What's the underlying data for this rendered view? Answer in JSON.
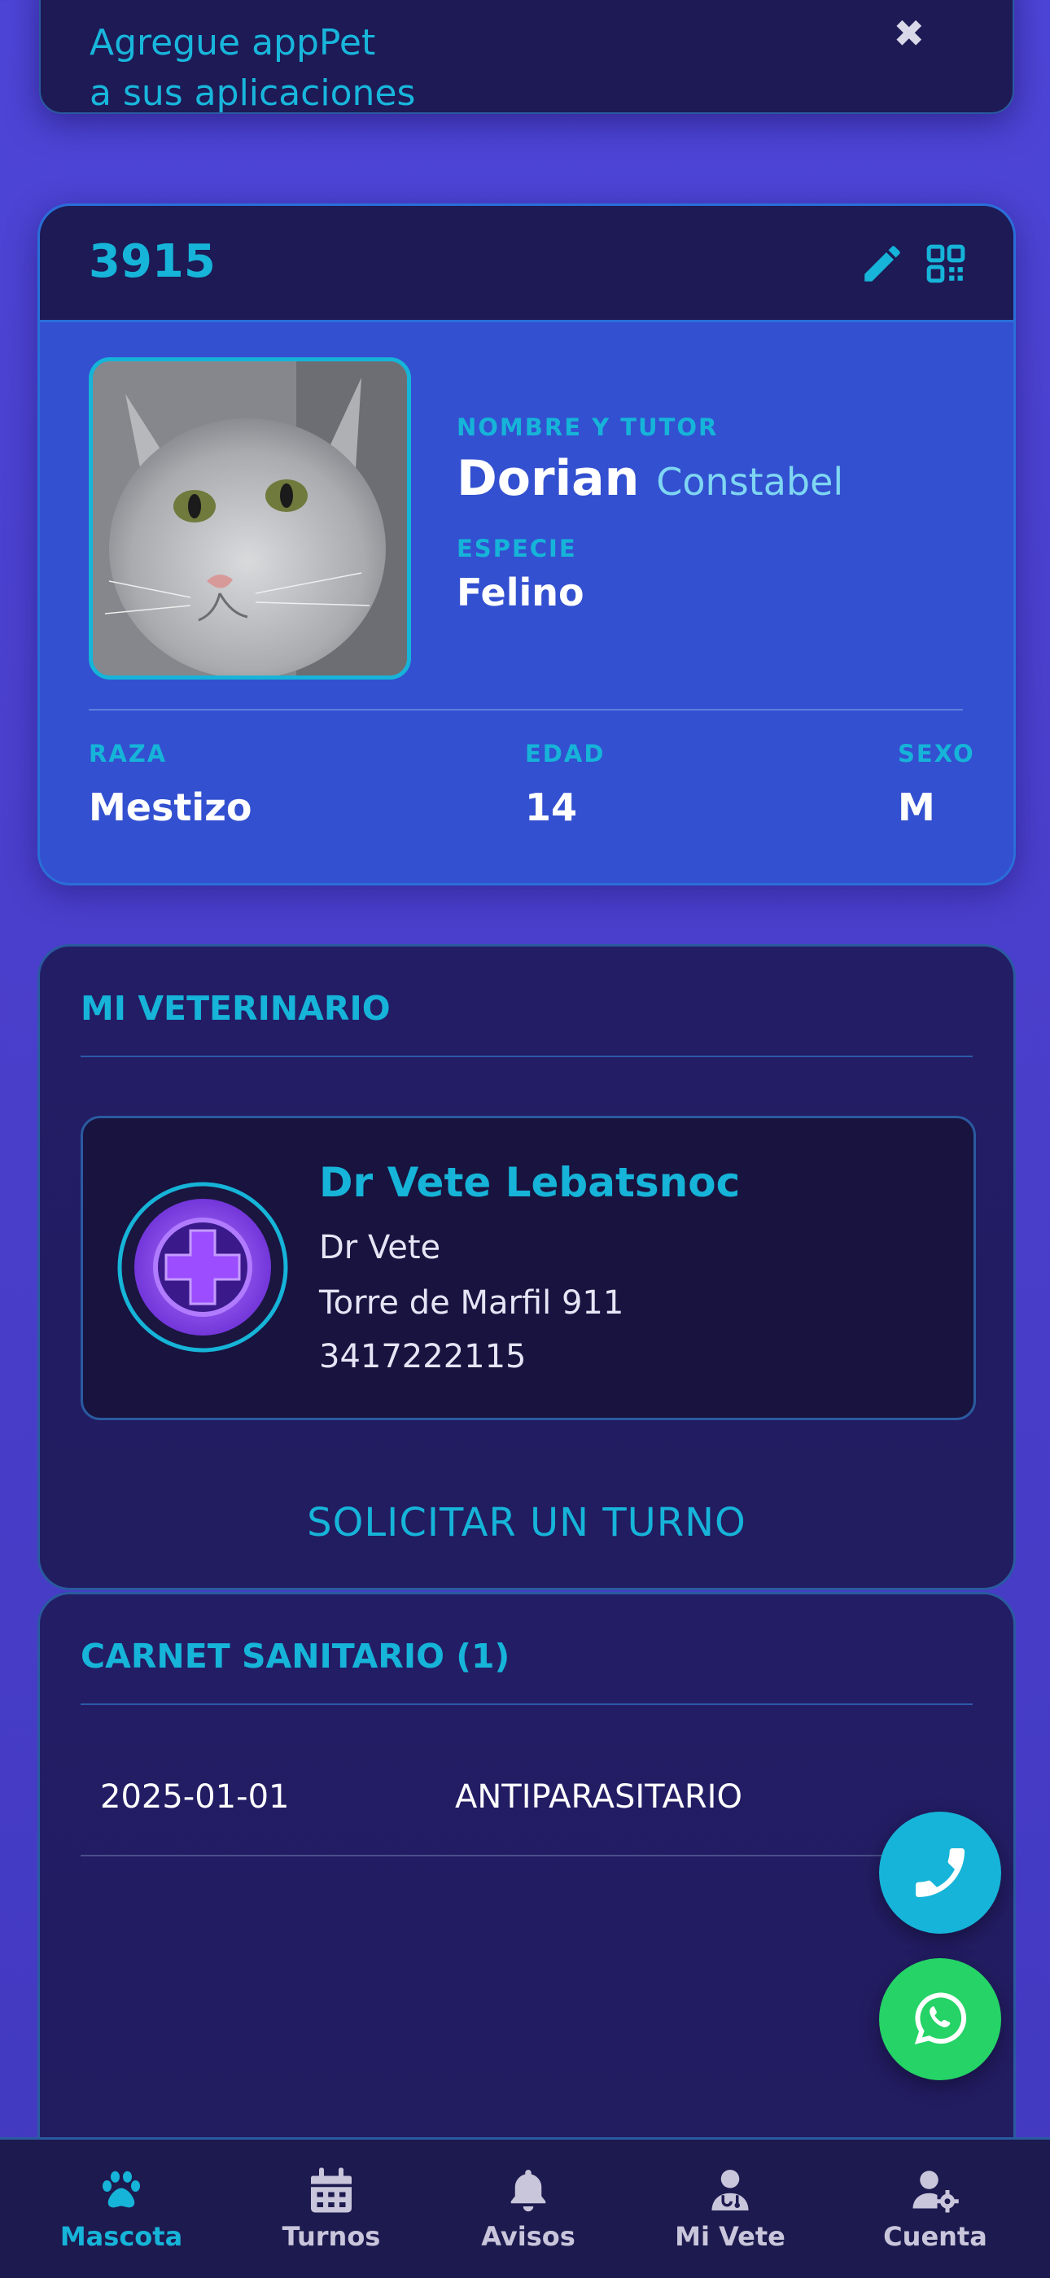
{
  "banner": {
    "text_line1": "Agregue appPet",
    "text_line2": "a sus aplicaciones",
    "close_glyph": "✖"
  },
  "pet": {
    "id": "3915",
    "name_label": "NOMBRE Y TUTOR",
    "name": "Dorian",
    "tutor": "Constabel",
    "species_label": "ESPECIE",
    "species": "Felino",
    "breed_label": "RAZA",
    "breed": "Mestizo",
    "age_label": "EDAD",
    "age": "14",
    "sex_label": "SEXO",
    "sex": "M",
    "icons": [
      "pencil-icon",
      "qr-code-icon"
    ]
  },
  "vet": {
    "title": "MI VETERINARIO",
    "name": "Dr Vete Lebatsnoc",
    "doctor": "Dr Vete",
    "address": "Torre de Marfil 911",
    "phone": "3417222115",
    "cta": "SOLICITAR UN TURNO"
  },
  "carnet": {
    "title": "CARNET SANITARIO (1)",
    "rows": [
      {
        "date": "2025-01-01",
        "type": "ANTIPARASITARIO"
      }
    ]
  },
  "fabs": {
    "phone_color": "#16b4d8",
    "whatsapp_color": "#25d366"
  },
  "nav": {
    "items": [
      {
        "label": "Mascota",
        "icon": "paw-icon",
        "active": true
      },
      {
        "label": "Turnos",
        "icon": "calendar-icon",
        "active": false
      },
      {
        "label": "Avisos",
        "icon": "bell-icon",
        "active": false
      },
      {
        "label": "Mi Vete",
        "icon": "doctor-icon",
        "active": false
      },
      {
        "label": "Cuenta",
        "icon": "user-cog-icon",
        "active": false
      }
    ]
  },
  "colors": {
    "accent": "#16b4d8",
    "card_blue": "#3350d0",
    "panel_dark": "#221c60",
    "nav_bg": "#1d1a4f"
  }
}
